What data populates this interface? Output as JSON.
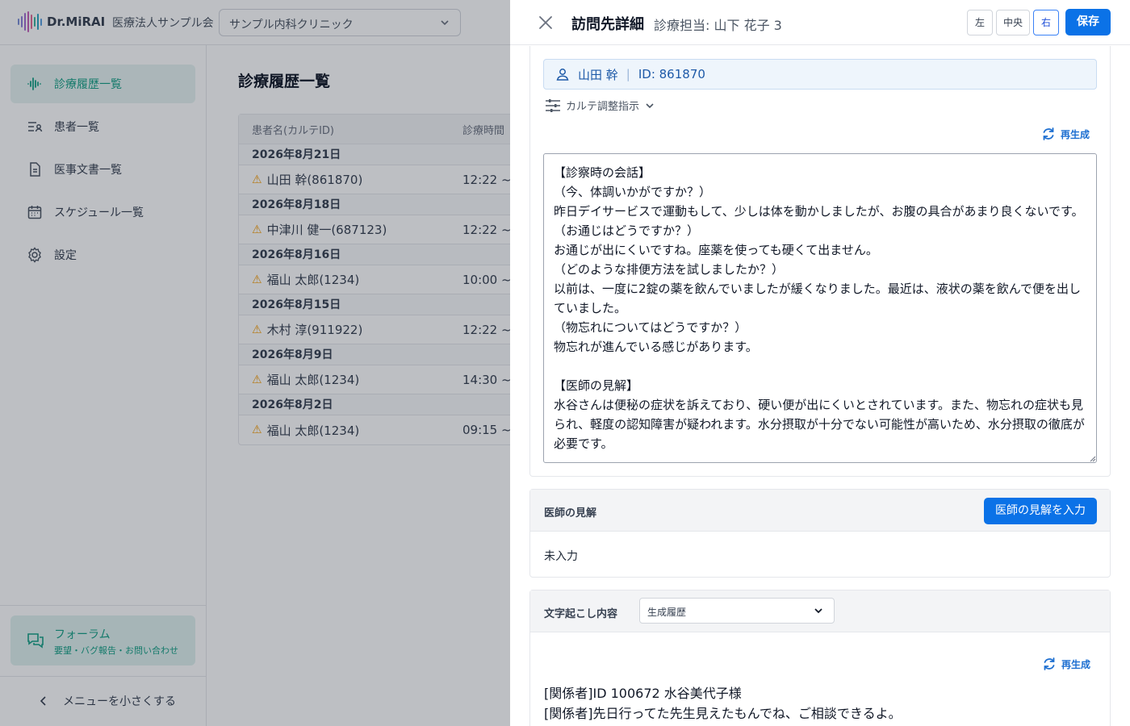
{
  "app": {
    "brand": "Dr.MiRAI",
    "org_name": "医療法人サンプル会",
    "clinic_select": "サンプル内科クリニック"
  },
  "sidebar": {
    "items": [
      {
        "label": "診療履歴一覧",
        "icon": "waveform-icon",
        "active": true
      },
      {
        "label": "患者一覧",
        "icon": "patient-list-icon"
      },
      {
        "label": "医事文書一覧",
        "icon": "document-icon"
      },
      {
        "label": "スケジュール一覧",
        "icon": "calendar-icon"
      },
      {
        "label": "設定",
        "icon": "gear-icon"
      }
    ],
    "forum": {
      "title": "フォーラム",
      "subtitle": "要望・バグ報告・お問い合わせ"
    },
    "collapse_label": "メニューを小さくする"
  },
  "main": {
    "title": "診療履歴一覧",
    "table": {
      "headers": [
        "患者名(カルテID)",
        "診療時間"
      ],
      "groups": [
        {
          "date": "2026年8月21日",
          "rows": [
            {
              "patient": "山田 幹(861870)",
              "time": "12:22 ~"
            }
          ]
        },
        {
          "date": "2026年8月18日",
          "rows": [
            {
              "patient": "中津川 健一(687123)",
              "time": "12:22 ~"
            }
          ]
        },
        {
          "date": "2026年8月16日",
          "rows": [
            {
              "patient": "福山 太郎(1234)",
              "time": "10:00 ~"
            }
          ]
        },
        {
          "date": "2026年8月15日",
          "rows": [
            {
              "patient": "木村 淳(911922)",
              "time": "12:22 ~"
            }
          ]
        },
        {
          "date": "2026年8月9日",
          "rows": [
            {
              "patient": "福山 太郎(1234)",
              "time": "14:30 ~"
            }
          ]
        },
        {
          "date": "2026年8月2日",
          "rows": [
            {
              "patient": "福山 太郎(1234)",
              "time": "09:15 ~"
            }
          ]
        }
      ]
    }
  },
  "drawer": {
    "title": "訪問先詳細",
    "subtitle": "診療担当: 山下 花子 3",
    "position_buttons": [
      {
        "label": "左"
      },
      {
        "label": "中央"
      },
      {
        "label": "右",
        "selected": true
      }
    ],
    "save_label": "保存",
    "patient": {
      "name": "山田 幹",
      "separator": "|",
      "id_text": "ID: 861870"
    },
    "adjust_label": "カルテ調整指示",
    "regen_label": "再生成",
    "notes_text": "【診察時の会話】\n（今、体調いかがですか？）\n昨日デイサービスで運動もして、少しは体を動かしましたが、お腹の具合があまり良くないです。\n（お通じはどうですか？）\nお通じが出にくいですね。座薬を使っても硬くて出ません。\n（どのような排便方法を試しましたか？）\n以前は、一度に2錠の薬を飲んでいましたが緩くなりました。最近は、液状の薬を飲んで便を出していました。\n（物忘れについてはどうですか？）\n物忘れが進んでいる感じがあります。\n\n【医師の見解】\n水谷さんは便秘の症状を訴えており、硬い便が出にくいとされています。また、物忘れの症状も見られ、軽度の認知障害が疑われます。水分摂取が十分でない可能性が高いため、水分摂取の徹底が必要です。",
    "opinion": {
      "label": "医師の見解",
      "button_label": "医師の見解を入力",
      "value": "未入力"
    },
    "transcript": {
      "label": "文字起こし内容",
      "select_value": "生成履歴",
      "regen_label": "再生成",
      "lines": [
        "[関係者]ID 100672 水谷美代子様",
        "[関係者]先日行ってた先生見えたもんでね、ご相談できるよ。"
      ]
    }
  },
  "colors": {
    "accent_teal": "#16a085",
    "primary_blue": "#0b72e7",
    "link_blue": "#1d6fd1",
    "warning": "#f59e0b"
  }
}
